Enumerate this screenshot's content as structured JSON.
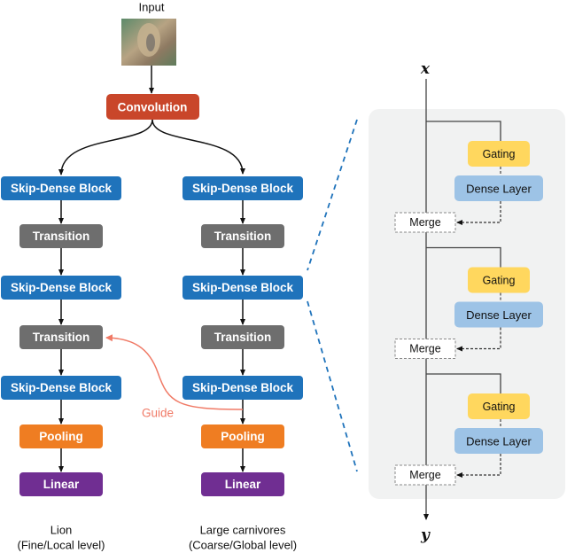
{
  "input_label": "Input",
  "convolution": "Convolution",
  "left_column": {
    "blocks": [
      "Skip-Dense Block",
      "Transition",
      "Skip-Dense Block",
      "Transition",
      "Skip-Dense Block",
      "Pooling",
      "Linear"
    ],
    "output_label": "Lion",
    "output_level": "(Fine/Local level)"
  },
  "right_column": {
    "blocks": [
      "Skip-Dense Block",
      "Transition",
      "Skip-Dense Block",
      "Transition",
      "Skip-Dense Block",
      "Pooling",
      "Linear"
    ],
    "output_label": "Large carnivores",
    "output_level": "(Coarse/Global level)"
  },
  "guide_label": "Guide",
  "detail": {
    "input": "x",
    "output": "y",
    "units": [
      {
        "gating": "Gating",
        "dense": "Dense Layer",
        "merge": "Merge"
      },
      {
        "gating": "Gating",
        "dense": "Dense Layer",
        "merge": "Merge"
      },
      {
        "gating": "Gating",
        "dense": "Dense Layer",
        "merge": "Merge"
      }
    ]
  },
  "colors": {
    "convolution": "#c9462a",
    "skip_dense": "#1f73bb",
    "transition": "#6e6e6e",
    "pooling": "#ef7d22",
    "linear": "#702e92",
    "gating": "#ffd75e",
    "dense": "#9dc3e6",
    "guide": "#f07a66",
    "panel": "#f1f2f2"
  }
}
